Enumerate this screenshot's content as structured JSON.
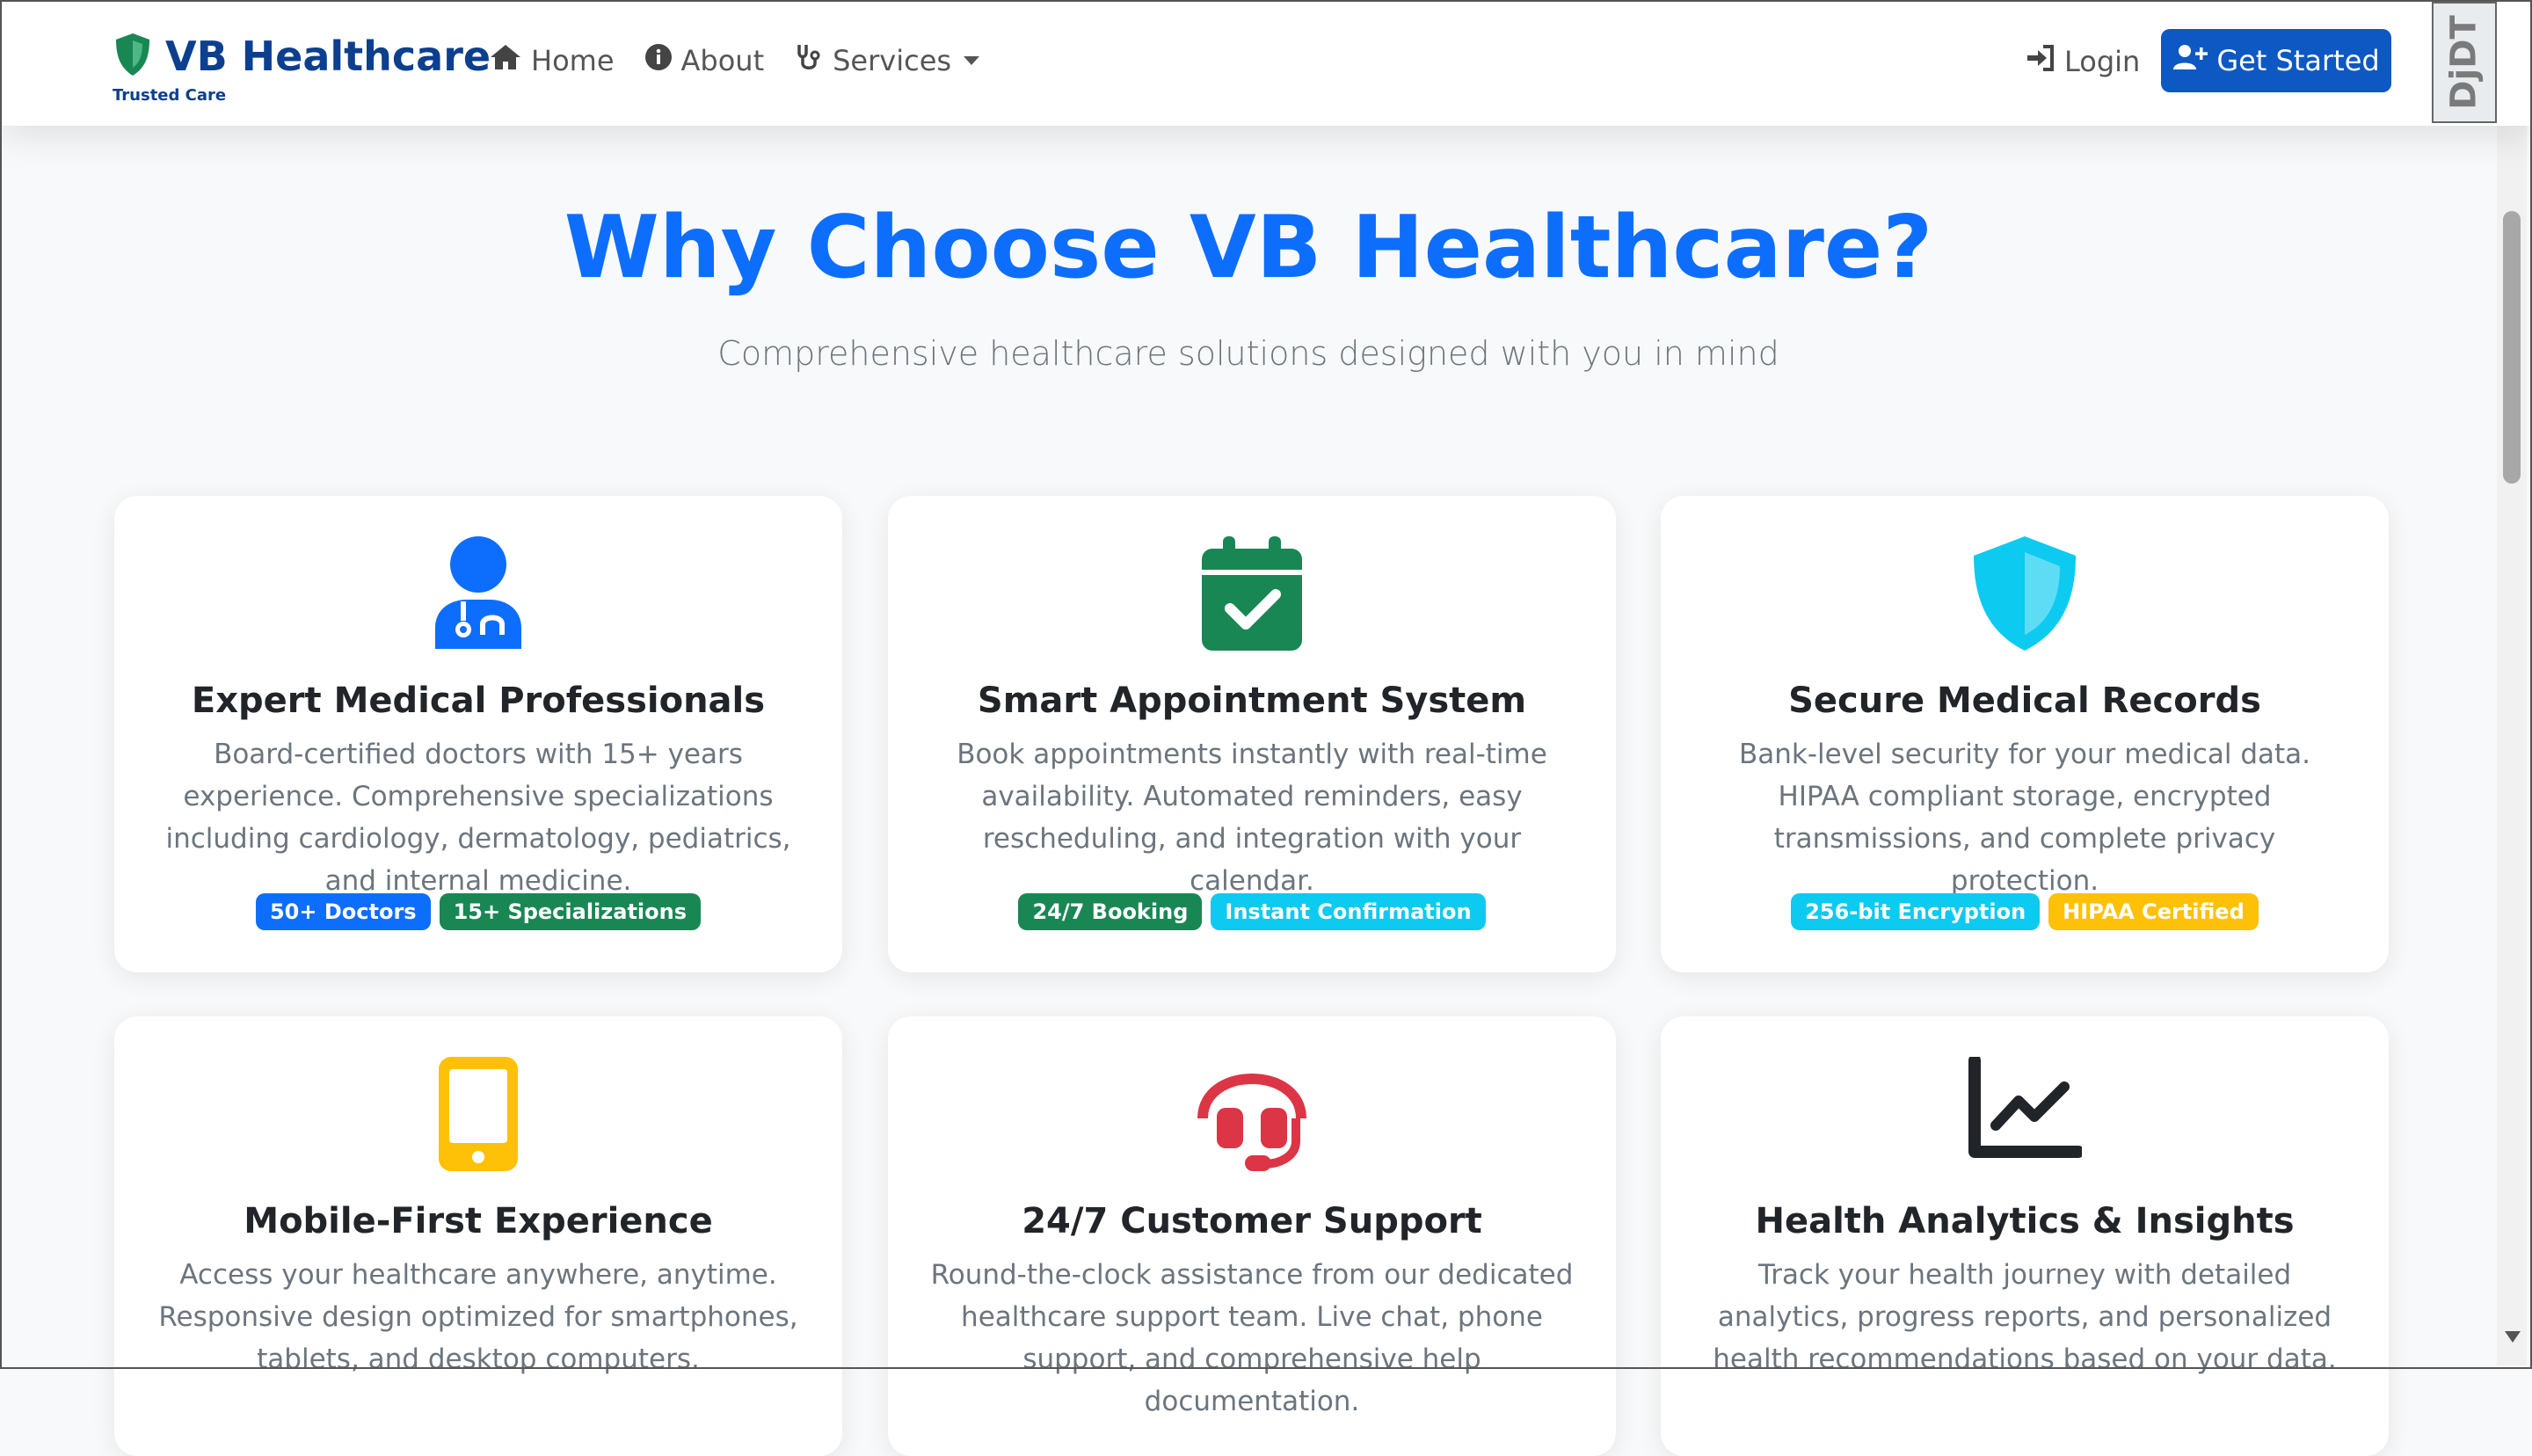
{
  "navbar": {
    "brand_title": "VB Healthcare",
    "brand_subtitle": "Trusted Care",
    "links": [
      {
        "label": "Home",
        "icon": "home-icon"
      },
      {
        "label": "About",
        "icon": "info-circle-icon"
      },
      {
        "label": "Services",
        "icon": "stethoscope-icon"
      }
    ],
    "login_label": "Login",
    "cta_label": "Get Started",
    "extension_badge": "DjDT"
  },
  "hero": {
    "title": "Why Choose VB Healthcare?",
    "subtitle": "Comprehensive healthcare solutions designed with you in mind"
  },
  "colors": {
    "primary": "#0d6efd",
    "success": "#198754",
    "info": "#0dcaf0",
    "warning": "#ffc107",
    "danger": "#dc3545",
    "dark": "#212529",
    "brand": "#0d3f8f"
  },
  "features": [
    {
      "icon": "doctor-icon",
      "title": "Expert Medical Professionals",
      "text": "Board-certified doctors with 15+ years experience. Comprehensive specializations including cardiology, dermatology, pediatrics, and internal medicine.",
      "badges": [
        {
          "label": "50+ Doctors",
          "color": "#0d6efd"
        },
        {
          "label": "15+ Specializations",
          "color": "#198754"
        }
      ]
    },
    {
      "icon": "calendar-check-icon",
      "title": "Smart Appointment System",
      "text": "Book appointments instantly with real-time availability. Automated reminders, easy rescheduling, and integration with your calendar.",
      "badges": [
        {
          "label": "24/7 Booking",
          "color": "#198754"
        },
        {
          "label": "Instant Confirmation",
          "color": "#0dcaf0"
        }
      ]
    },
    {
      "icon": "shield-icon",
      "title": "Secure Medical Records",
      "text": "Bank-level security for your medical data. HIPAA compliant storage, encrypted transmissions, and complete privacy protection.",
      "badges": [
        {
          "label": "256-bit Encryption",
          "color": "#0dcaf0"
        },
        {
          "label": "HIPAA Certified",
          "color": "#ffc107"
        }
      ]
    },
    {
      "icon": "mobile-icon",
      "title": "Mobile-First Experience",
      "text": "Access your healthcare anywhere, anytime. Responsive design optimized for smartphones, tablets, and desktop computers."
    },
    {
      "icon": "headset-icon",
      "title": "24/7 Customer Support",
      "text": "Round-the-clock assistance from our dedicated healthcare support team. Live chat, phone support, and comprehensive help documentation."
    },
    {
      "icon": "chart-line-icon",
      "title": "Health Analytics & Insights",
      "text": "Track your health journey with detailed analytics, progress reports, and personalized health recommendations based on your data."
    }
  ]
}
